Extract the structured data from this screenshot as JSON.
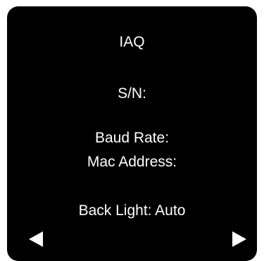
{
  "device": {
    "title": "IAQ",
    "serial_label": "S/N:",
    "baud_rate_label": "Baud Rate:",
    "mac_address_label": "Mac Address:",
    "back_light_label": "Back Light: Auto"
  },
  "navigation": {
    "prev_icon": "triangle-left-icon",
    "next_icon": "triangle-right-icon"
  },
  "colors": {
    "screen_background": "#000000",
    "text": "#ffffff"
  }
}
